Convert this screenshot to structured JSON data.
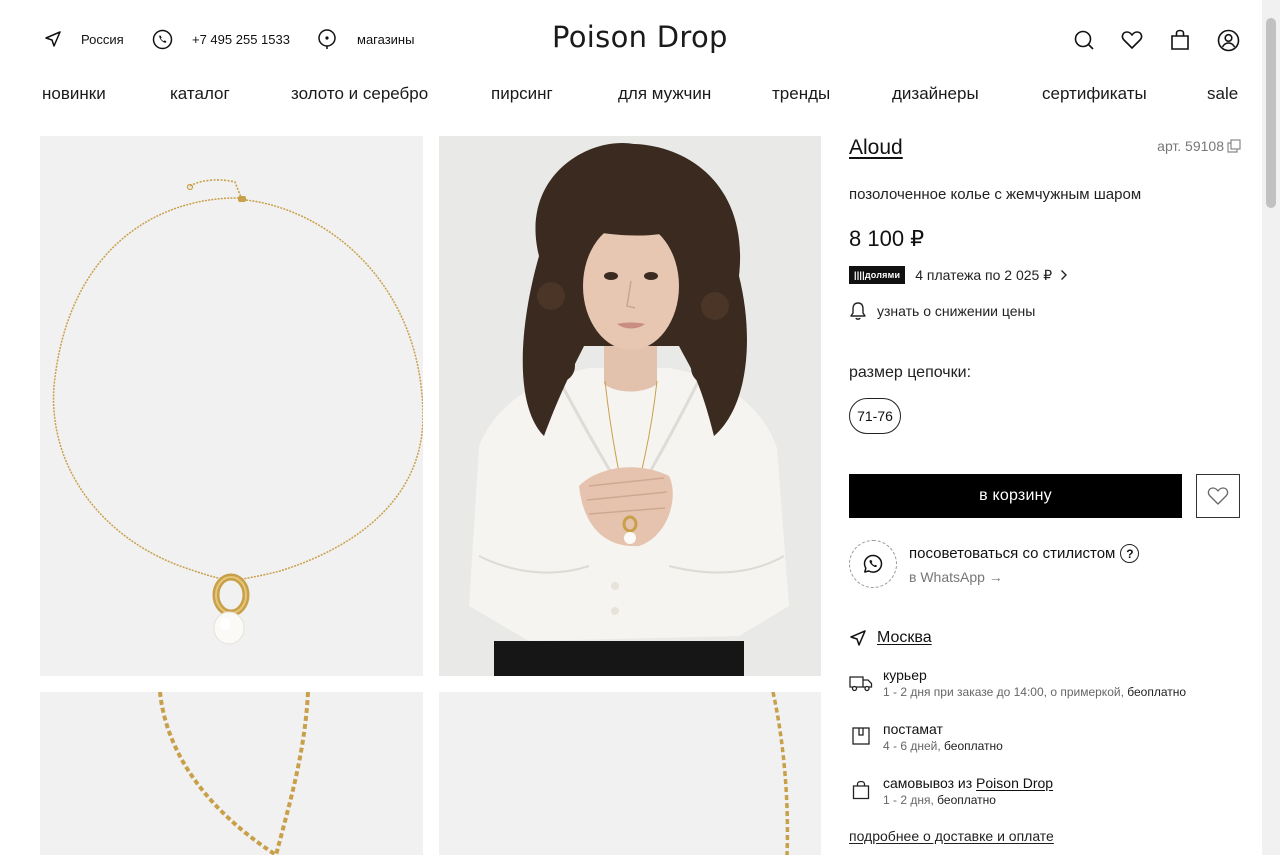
{
  "header": {
    "region": "Россия",
    "phone": "+7 495 255 1533",
    "stores": "магазины",
    "logo": "Poison Drop"
  },
  "nav": {
    "items": [
      "новинки",
      "каталог",
      "золото и серебро",
      "пирсинг",
      "для мужчин",
      "тренды",
      "дизайнеры",
      "сертификаты",
      "sale"
    ]
  },
  "product": {
    "brand": "Aloud",
    "sku": "арт. 59108",
    "description": "позолоченное колье с жемчужным шаром",
    "price": "8 100 ₽",
    "dolyami_badge": "||||долями",
    "dolyami_text": "4 платежа по 2 025 ₽",
    "price_alert": "узнать о снижении цены",
    "size_label": "размер цепочки:",
    "size_value": "71-76",
    "cart_button": "в корзину"
  },
  "stylist": {
    "title": "посоветоваться со стилистом",
    "question_mark": "?",
    "whatsapp": "в WhatsApp →"
  },
  "delivery": {
    "city": "Москва",
    "options": [
      {
        "title": "курьер",
        "sub": "1 - 2 дня при заказе до 14:00, о примеркой,",
        "free": "беоплатно"
      },
      {
        "title": "постамат",
        "sub": "4 - 6 дней,",
        "free": "беоплатно"
      },
      {
        "title_prefix": "самовывоз из",
        "title_link": "Poison Drop",
        "sub": "1 - 2 дня,",
        "free": "беоплатно"
      }
    ],
    "more_link": "подробнее о доставке и оплате"
  },
  "colors": {
    "accent": "#000000",
    "photo_bg": "#f1f1f1",
    "gold": "#c9a04a"
  }
}
